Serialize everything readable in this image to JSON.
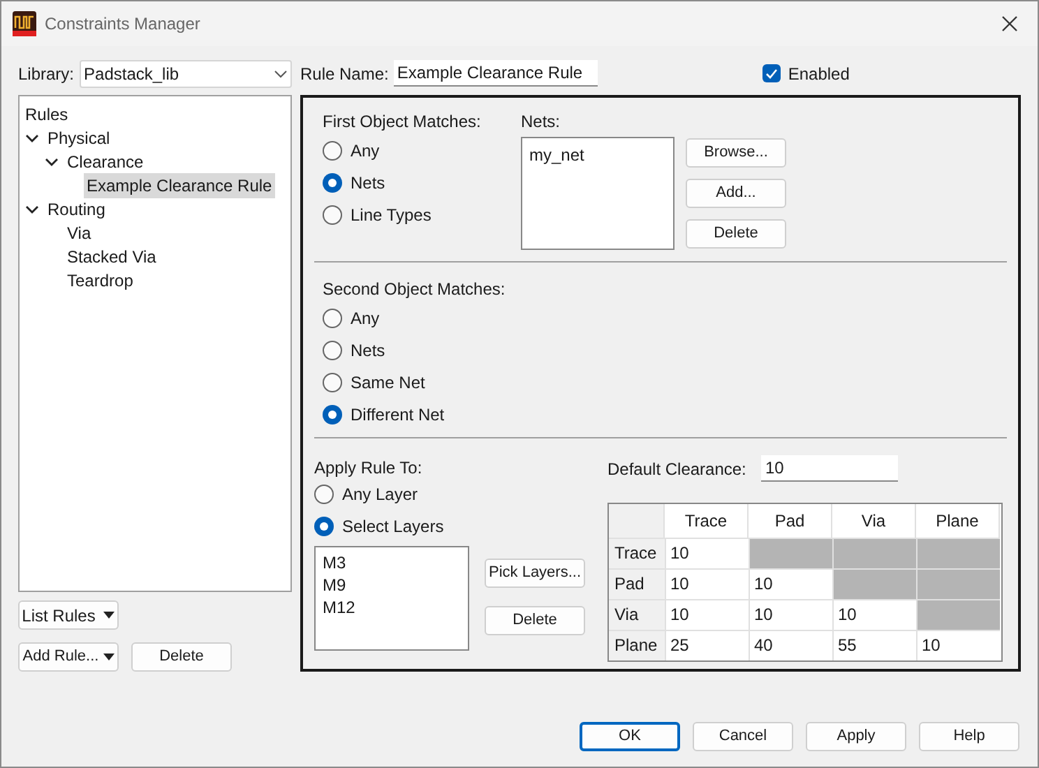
{
  "window": {
    "title": "Constraints Manager"
  },
  "library": {
    "label": "Library:",
    "value": "Padstack_lib"
  },
  "rule_name": {
    "label": "Rule Name:",
    "value": "Example Clearance Rule"
  },
  "enabled": {
    "label": "Enabled",
    "checked": true
  },
  "tree": {
    "root": "Rules",
    "items": [
      {
        "label": "Physical",
        "expanded": true,
        "selected": false,
        "children": [
          {
            "label": "Clearance",
            "expanded": true,
            "selected": false,
            "children": [
              {
                "label": "Example Clearance Rule",
                "selected": true
              }
            ]
          }
        ]
      },
      {
        "label": "Routing",
        "expanded": true,
        "selected": false,
        "children": [
          {
            "label": "Via",
            "selected": false
          },
          {
            "label": "Stacked Via",
            "selected": false
          },
          {
            "label": "Teardrop",
            "selected": false
          }
        ]
      }
    ]
  },
  "first_object": {
    "label": "First Object Matches:",
    "options": [
      {
        "label": "Any",
        "selected": false
      },
      {
        "label": "Nets",
        "selected": true
      },
      {
        "label": "Line Types",
        "selected": false
      }
    ]
  },
  "nets": {
    "label": "Nets:",
    "items": [
      "my_net"
    ],
    "buttons": [
      "Browse...",
      "Add...",
      "Delete"
    ]
  },
  "second_object": {
    "label": "Second Object Matches:",
    "options": [
      {
        "label": "Any",
        "selected": false
      },
      {
        "label": "Nets",
        "selected": false
      },
      {
        "label": "Same Net",
        "selected": false
      },
      {
        "label": "Different Net",
        "selected": true
      }
    ]
  },
  "apply_rule": {
    "label": "Apply Rule To:",
    "options": [
      {
        "label": "Any Layer",
        "selected": false
      },
      {
        "label": "Select Layers",
        "selected": true
      }
    ],
    "layers": [
      "M3",
      "M9",
      "M12"
    ],
    "buttons": [
      "Pick Layers...",
      "Delete"
    ]
  },
  "default_clearance": {
    "label": "Default Clearance:",
    "value": "10"
  },
  "matrix": {
    "columns": [
      "Trace",
      "Pad",
      "Via",
      "Plane"
    ],
    "rows": [
      {
        "label": "Trace",
        "cells": [
          {
            "value": "10",
            "disabled": false
          },
          {
            "disabled": true
          },
          {
            "disabled": true
          },
          {
            "disabled": true
          }
        ]
      },
      {
        "label": "Pad",
        "cells": [
          {
            "value": "10",
            "disabled": false
          },
          {
            "value": "10",
            "disabled": false
          },
          {
            "disabled": true
          },
          {
            "disabled": true
          }
        ]
      },
      {
        "label": "Via",
        "cells": [
          {
            "value": "10",
            "disabled": false
          },
          {
            "value": "10",
            "disabled": false
          },
          {
            "value": "10",
            "disabled": false
          },
          {
            "disabled": true
          }
        ]
      },
      {
        "label": "Plane",
        "cells": [
          {
            "value": "25",
            "disabled": false
          },
          {
            "value": "40",
            "disabled": false
          },
          {
            "value": "55",
            "disabled": false
          },
          {
            "value": "10",
            "disabled": false
          }
        ]
      }
    ]
  },
  "list_rules": "List Rules",
  "add_rule": "Add Rule...",
  "delete_rule": "Delete",
  "footer_buttons": [
    {
      "label": "OK",
      "default": true
    },
    {
      "label": "Cancel",
      "default": false
    },
    {
      "label": "Apply",
      "default": false
    },
    {
      "label": "Help",
      "default": false
    }
  ]
}
